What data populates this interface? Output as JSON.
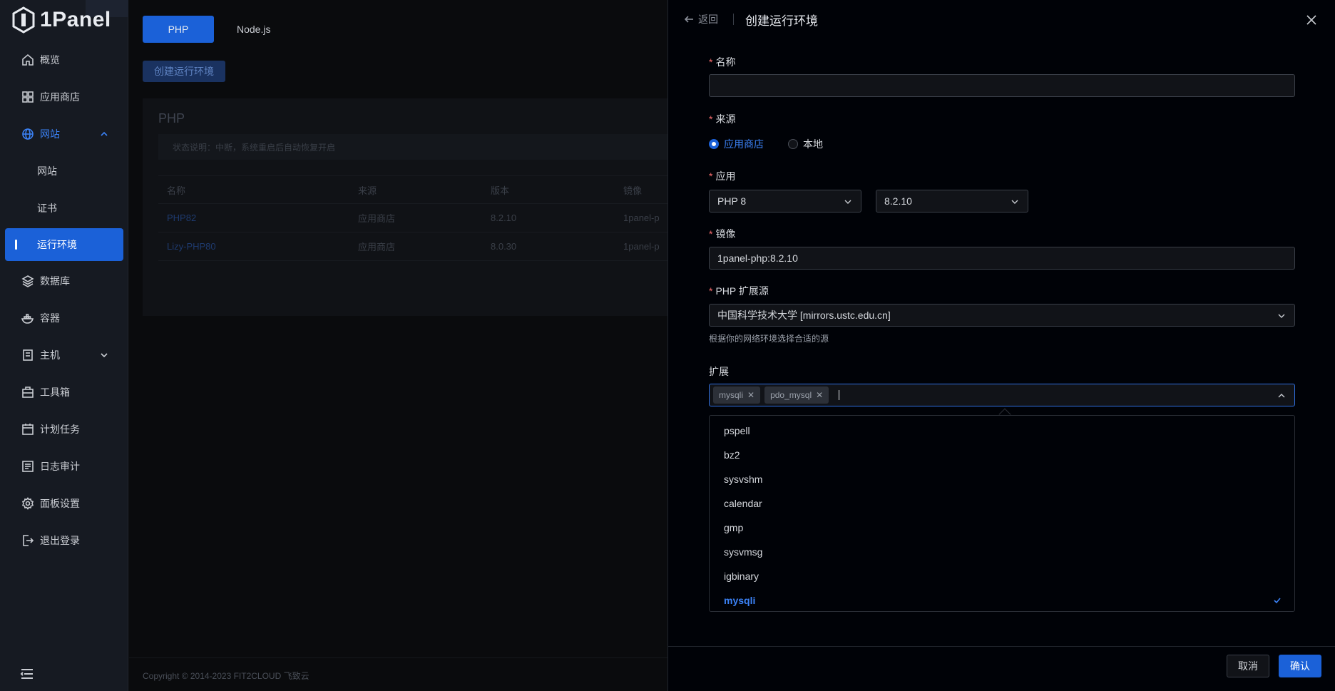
{
  "sidebar": {
    "logo_text": "1Panel",
    "items": [
      {
        "label": "概览",
        "icon": "home-icon"
      },
      {
        "label": "应用商店",
        "icon": "grid-icon"
      },
      {
        "label": "网站",
        "icon": "globe-icon"
      },
      {
        "label": "网站"
      },
      {
        "label": "证书"
      },
      {
        "label": "运行环境"
      },
      {
        "label": "数据库",
        "icon": "layers-icon"
      },
      {
        "label": "容器",
        "icon": "docker-icon"
      },
      {
        "label": "主机",
        "icon": "server-icon"
      },
      {
        "label": "工具箱",
        "icon": "toolbox-icon"
      },
      {
        "label": "计划任务",
        "icon": "calendar-icon"
      },
      {
        "label": "日志审计",
        "icon": "log-icon"
      },
      {
        "label": "面板设置",
        "icon": "gear-icon"
      },
      {
        "label": "退出登录",
        "icon": "logout-icon"
      }
    ]
  },
  "main": {
    "tabs": [
      "PHP",
      "Node.js"
    ],
    "create_button": "创建运行环境",
    "card_title": "PHP",
    "alert": "状态说明：中断，系统重启后自动恢复开启",
    "table": {
      "headers": [
        "名称",
        "来源",
        "版本",
        "镜像"
      ],
      "rows": [
        [
          "PHP82",
          "应用商店",
          "8.2.10",
          "1panel-p"
        ],
        [
          "Lizy-PHP80",
          "应用商店",
          "8.0.30",
          "1panel-p"
        ]
      ]
    },
    "copyright": "Copyright © 2014-2023 FIT2CLOUD 飞致云"
  },
  "drawer": {
    "back_label": "返回",
    "title": "创建运行环境",
    "name_label": "名称",
    "name_value": "",
    "source_label": "来源",
    "source_options": [
      "应用商店",
      "本地"
    ],
    "app_label": "应用",
    "app_value": "PHP 8",
    "version_value": "8.2.10",
    "image_label": "镜像",
    "image_value": "1panel-php:8.2.10",
    "ext_source_label": "PHP 扩展源",
    "ext_source_value": "中国科学技术大学 [mirrors.ustc.edu.cn]",
    "ext_source_help": "根据你的网络环境选择合适的源",
    "ext_label": "扩展",
    "ext_tags": [
      "mysqli",
      "pdo_mysql"
    ],
    "ext_options": [
      "pspell",
      "bz2",
      "sysvshm",
      "calendar",
      "gmp",
      "sysvmsg",
      "igbinary",
      "mysqli"
    ],
    "cancel": "取消",
    "confirm": "确认"
  },
  "colors": {
    "accent": "#1b61d8",
    "link": "#3b82f6",
    "required": "#f56c6c"
  }
}
